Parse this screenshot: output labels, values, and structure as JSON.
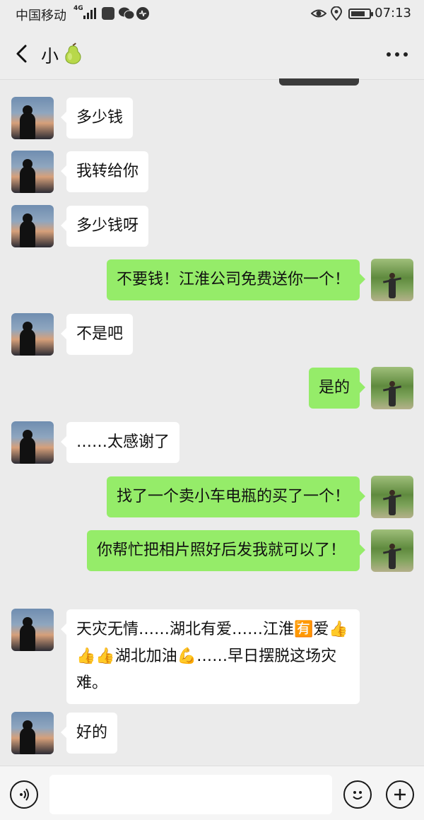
{
  "status_bar": {
    "carrier": "中国移动",
    "network": "4G",
    "time": "07:13",
    "battery_level": 0.68,
    "icons": [
      "signal-icon",
      "app-icon",
      "wechat-icon",
      "music-icon",
      "eye-icon",
      "location-icon",
      "battery-icon"
    ]
  },
  "header": {
    "back_icon": "chevron-left-icon",
    "title": "小",
    "title_emoji": "pear-emoji",
    "more_icon": "more-dots-icon"
  },
  "messages": [
    {
      "side": "left",
      "text": "多少钱"
    },
    {
      "side": "left",
      "text": "我转给你"
    },
    {
      "side": "left",
      "text": "多少钱呀"
    },
    {
      "side": "right",
      "text": "不要钱！江淮公司免费送你一个！"
    },
    {
      "side": "left",
      "text": "不是吧"
    },
    {
      "side": "right",
      "text": "是的"
    },
    {
      "side": "left",
      "text": "……太感谢了"
    },
    {
      "side": "right",
      "text": "找了一个卖小车电瓶的买了一个！"
    },
    {
      "side": "right",
      "text": "你帮忙把相片照好后发我就可以了！"
    },
    {
      "side": "left",
      "text": "天灾无情……湖北有爱……江淮🈶爱👍👍👍湖北加油💪……早日摆脱这场灾难。"
    },
    {
      "side": "left",
      "text": "好的"
    }
  ],
  "input_bar": {
    "placeholder": "",
    "voice_icon": "voice-icon",
    "emoji_icon": "emoji-icon",
    "plus_icon": "plus-icon"
  },
  "colors": {
    "background": "#ebebeb",
    "bubble_left": "#ffffff",
    "bubble_right": "#95ec69",
    "header": "#ededed"
  }
}
